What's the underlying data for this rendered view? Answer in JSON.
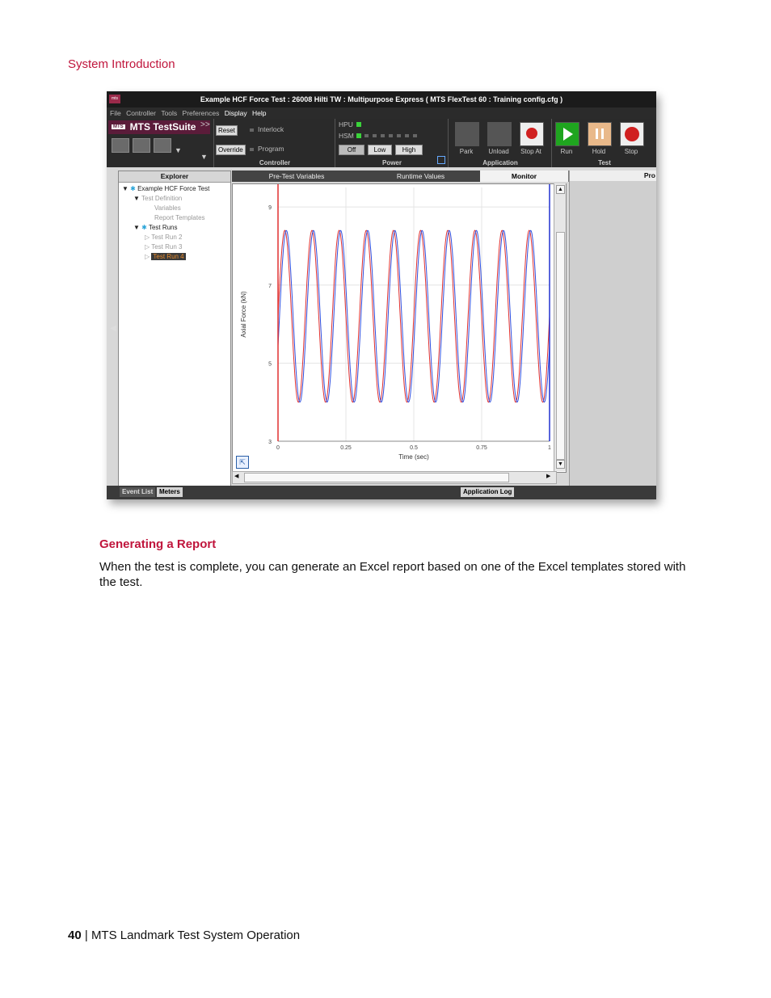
{
  "page": {
    "section_header": "System Introduction",
    "subheading": "Generating a Report",
    "body": "When the test is complete, you can generate an Excel report based on one of the Excel templates stored with the test.",
    "footer_page_number": "40",
    "footer_separator": "|",
    "footer_title": "MTS Landmark Test System Operation"
  },
  "app": {
    "title": "Example HCF Force Test : 26008 Hilti TW : Multipurpose Express ( MTS FlexTest 60 : Training config.cfg )",
    "app_icon": "mts",
    "menu": [
      "File",
      "Controller",
      "Tools",
      "Preferences",
      "Display",
      "Help"
    ],
    "logo_mts": "MTS",
    "logo_text": "MTS TestSuite",
    "chevrons": ">>",
    "controller": {
      "reset": "Reset",
      "interlock": "Interlock",
      "override": "Override",
      "program": "Program",
      "label": "Controller"
    },
    "power": {
      "hpu": "HPU",
      "hsm": "HSM",
      "off": "Off",
      "low": "Low",
      "high": "High",
      "label": "Power"
    },
    "application": {
      "park": "Park",
      "unload": "Unload",
      "stop_at": "Stop At",
      "label": "Application"
    },
    "test": {
      "run": "Run",
      "hold": "Hold",
      "stop": "Stop",
      "label": "Test"
    },
    "explorer": {
      "title": "Explorer",
      "root": "Example HCF Force Test",
      "test_definition": "Test Definition",
      "variables": "Variables",
      "report_templates": "Report Templates",
      "test_runs": "Test Runs",
      "runs": [
        "Test Run 2",
        "Test Run 3",
        "Test Run 4"
      ]
    },
    "tabs": [
      "Pre-Test Variables",
      "Runtime Values",
      "Monitor"
    ],
    "right_panel_title": "Pro",
    "bottom_tabs": [
      "Event List",
      "Meters",
      "Application Log"
    ]
  },
  "chart_data": {
    "type": "line",
    "xlabel": "Time (sec)",
    "ylabel": "Axial Force (kN)",
    "xlim": [
      0,
      1
    ],
    "ylim": [
      3,
      9.5
    ],
    "x_ticks": [
      "0",
      "0.25",
      "0.5",
      "0.75",
      "1"
    ],
    "y_ticks": [
      "3",
      "5",
      "7",
      "9"
    ],
    "series": [
      {
        "color": "#e03030",
        "amplitude": 2.2,
        "offset": 6.2,
        "frequency_hz": 10,
        "phase": 0.0
      },
      {
        "color": "#3050e0",
        "amplitude": 2.2,
        "offset": 6.2,
        "frequency_hz": 10,
        "phase": -0.35
      }
    ],
    "markers": [
      {
        "x": 0,
        "color": "#e03030"
      },
      {
        "x": 1,
        "color": "#2030d0"
      }
    ],
    "colors": {
      "accent": "#c0153c"
    }
  }
}
